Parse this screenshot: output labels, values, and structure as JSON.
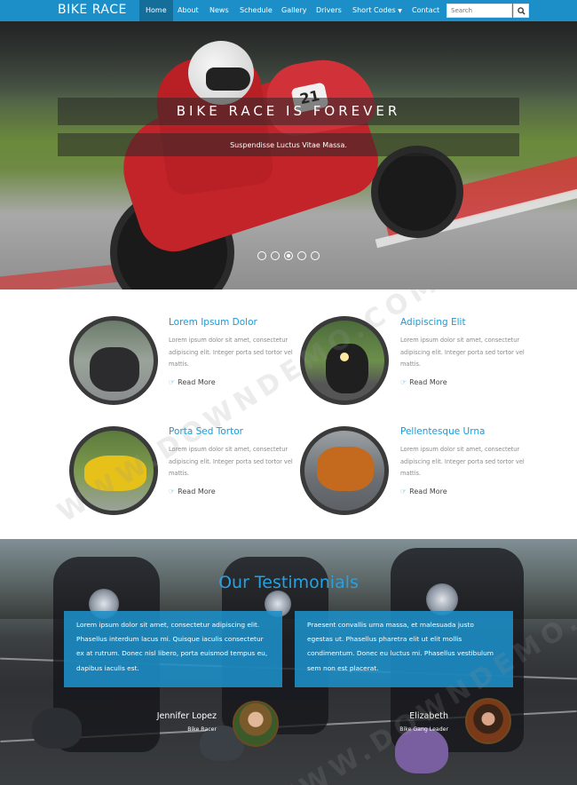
{
  "brand": "BIKE RACE",
  "nav": {
    "items": [
      {
        "label": "Home",
        "active": true
      },
      {
        "label": "About",
        "active": false
      },
      {
        "label": "News",
        "active": false
      },
      {
        "label": "Schedule",
        "active": false
      },
      {
        "label": "Gallery",
        "active": false
      },
      {
        "label": "Drivers",
        "active": false
      },
      {
        "label": "Short Codes",
        "active": false,
        "dropdown": true
      },
      {
        "label": "Contact",
        "active": false
      }
    ],
    "search_placeholder": "Search",
    "search_icon": "magnifier-icon"
  },
  "hero": {
    "title": "BIKE RACE IS FOREVER",
    "subtitle": "Suspendisse Luctus Vitae Massa.",
    "bike_number": "21",
    "slides": 5,
    "active_slide": 3
  },
  "features": [
    {
      "title": "Lorem Ipsum Dolor",
      "text": "Lorem ipsum dolor sit amet, consectetur adipiscing elit. Integer porta sed tortor vel mattis.",
      "link": "Read More"
    },
    {
      "title": "Adipiscing Elit",
      "text": "Lorem ipsum dolor sit amet, consectetur adipiscing elit. Integer porta sed tortor vel mattis.",
      "link": "Read More"
    },
    {
      "title": "Porta Sed Tortor",
      "text": "Lorem ipsum dolor sit amet, consectetur adipiscing elit. Integer porta sed tortor vel mattis.",
      "link": "Read More"
    },
    {
      "title": "Pellentesque Urna",
      "text": "Lorem ipsum dolor sit amet, consectetur adipiscing elit. Integer porta sed tortor vel mattis.",
      "link": "Read More"
    }
  ],
  "testimonials": {
    "heading": "Our Testimonials",
    "items": [
      {
        "quote": "Lorem ipsum dolor sit amet, consectetur adipiscing elit. Phasellus interdum lacus mi. Quisque iaculis consectetur ex at rutrum. Donec nisl libero, porta euismod tempus eu, dapibus iaculis est.",
        "name": "Jennifer Lopez",
        "role": "Bike Racer"
      },
      {
        "quote": "Praesent convallis urna massa, et malesuada justo egestas ut. Phasellus pharetra elit ut elit mollis condimentum. Donec eu luctus mi. Phasellus vestibulum sem non est placerat.",
        "name": "Elizabeth",
        "role": "Bike Gang Leader"
      }
    ]
  },
  "colors": {
    "accent": "#1c8fc8",
    "title_blue": "#1c9ad6",
    "nav_active": "#156d99"
  },
  "watermark": "WWW.DOWNDEMO.COM"
}
